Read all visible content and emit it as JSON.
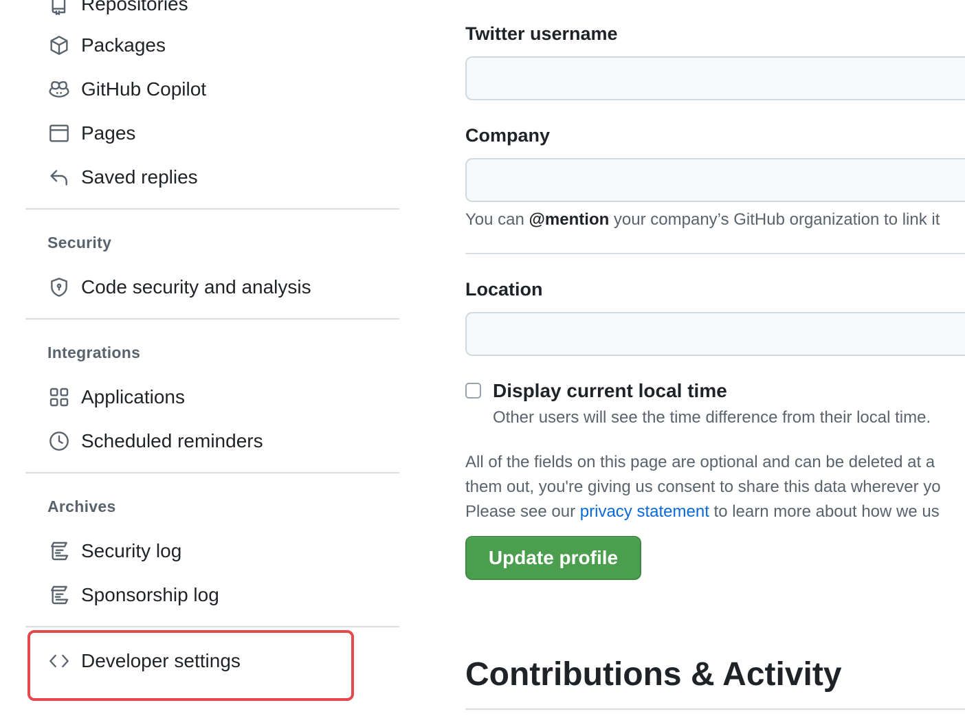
{
  "sidebar": {
    "items_top": [
      {
        "label": "Repositories",
        "icon": "repo-icon"
      },
      {
        "label": "Packages",
        "icon": "package-icon"
      },
      {
        "label": "GitHub Copilot",
        "icon": "copilot-icon"
      },
      {
        "label": "Pages",
        "icon": "browser-icon"
      },
      {
        "label": "Saved replies",
        "icon": "reply-icon"
      }
    ],
    "security": {
      "title": "Security",
      "items": [
        {
          "label": "Code security and analysis",
          "icon": "shield-lock-icon"
        }
      ]
    },
    "integrations": {
      "title": "Integrations",
      "items": [
        {
          "label": "Applications",
          "icon": "apps-icon"
        },
        {
          "label": "Scheduled reminders",
          "icon": "clock-icon"
        }
      ]
    },
    "archives": {
      "title": "Archives",
      "items": [
        {
          "label": "Security log",
          "icon": "log-icon"
        },
        {
          "label": "Sponsorship log",
          "icon": "log-icon"
        }
      ]
    },
    "developer": {
      "label": "Developer settings",
      "icon": "code-icon"
    }
  },
  "form": {
    "twitter": {
      "label": "Twitter username",
      "value": ""
    },
    "company": {
      "label": "Company",
      "value": "",
      "help_prefix": "You can ",
      "help_bold": "@mention",
      "help_suffix": " your company’s GitHub organization to link it"
    },
    "location": {
      "label": "Location",
      "value": ""
    },
    "local_time": {
      "label": "Display current local time",
      "checked": false,
      "note": "Other users will see the time difference from their local time."
    },
    "disclaimer": {
      "line1": "All of the fields on this page are optional and can be deleted at a",
      "line2": "them out, you're giving us consent to share this data wherever yo",
      "line3_prefix": "Please see our ",
      "line3_link": "privacy statement",
      "line3_suffix": " to learn more about how we us"
    },
    "submit_label": "Update profile"
  },
  "contributions": {
    "heading": "Contributions & Activity"
  },
  "colors": {
    "accent_green": "#4c9e4f",
    "link_blue": "#0969da",
    "highlight_red": "#e5484d"
  }
}
